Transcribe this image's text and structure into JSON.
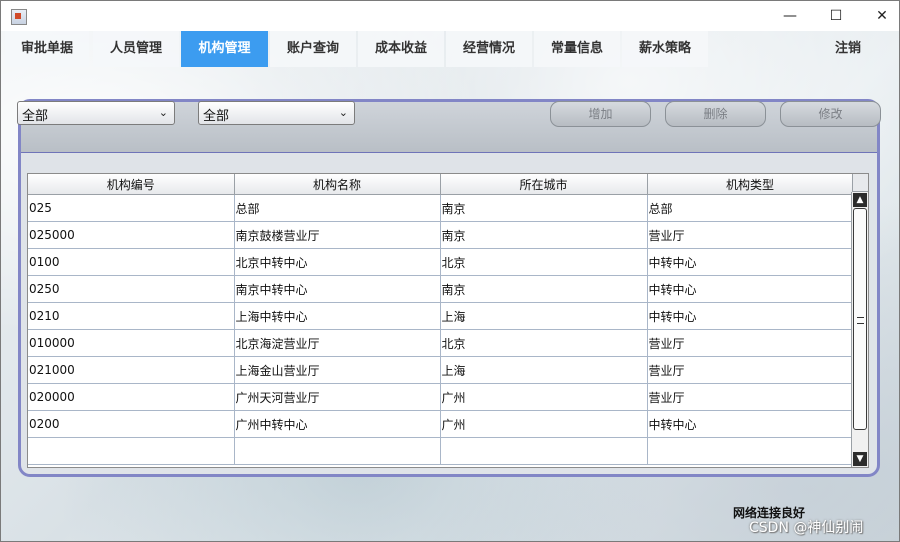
{
  "nav": {
    "tabs": [
      "审批单据",
      "人员管理",
      "机构管理",
      "账户查询",
      "成本收益",
      "经营情况",
      "常量信息",
      "薪水策略"
    ],
    "active_index": 2,
    "logout_label": "注销"
  },
  "filters": {
    "combo1_value": "全部",
    "combo2_value": "全部"
  },
  "actions": {
    "add_label": "增加",
    "delete_label": "删除",
    "modify_label": "修改"
  },
  "table": {
    "columns": [
      "机构编号",
      "机构名称",
      "所在城市",
      "机构类型"
    ],
    "rows": [
      [
        "025",
        "总部",
        "南京",
        "总部"
      ],
      [
        "025000",
        "南京鼓楼营业厅",
        "南京",
        "营业厅"
      ],
      [
        "0100",
        "北京中转中心",
        "北京",
        "中转中心"
      ],
      [
        "0250",
        "南京中转中心",
        "南京",
        "中转中心"
      ],
      [
        "0210",
        "上海中转中心",
        "上海",
        "中转中心"
      ],
      [
        "010000",
        "北京海淀营业厅",
        "北京",
        "营业厅"
      ],
      [
        "021000",
        "上海金山营业厅",
        "上海",
        "营业厅"
      ],
      [
        "020000",
        "广州天河营业厅",
        "广州",
        "营业厅"
      ],
      [
        "0200",
        "广州中转中心",
        "广州",
        "中转中心"
      ],
      [
        "",
        "",
        "",
        ""
      ]
    ]
  },
  "status_text": "网络连接良好",
  "watermark": "CSDN @神仙别闹",
  "colors": {
    "accent_tab": "#3c9cf0",
    "panel_border": "#8286c6"
  }
}
